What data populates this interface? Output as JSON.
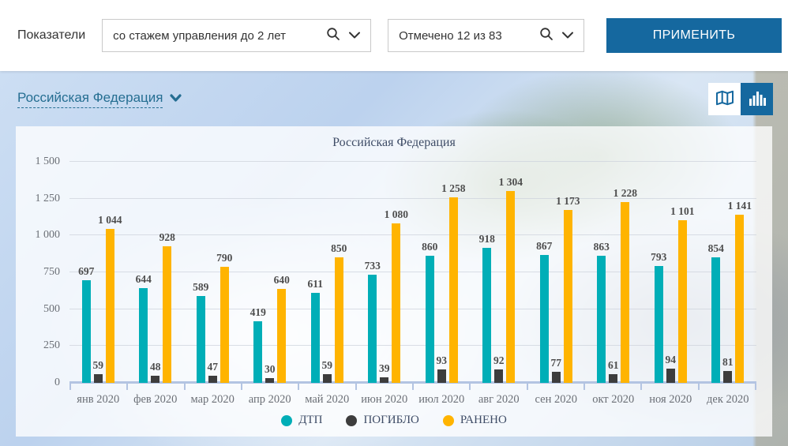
{
  "header": {
    "indicators_label": "Показатели",
    "indicator_select": {
      "value": "со стажем управления до 2 лет"
    },
    "regions_select": {
      "value": "Отмечено 12 из 83"
    },
    "apply_button": "ПРИМЕНИТЬ"
  },
  "breadcrumb": {
    "region": "Российская Федерация"
  },
  "view_toggle": {
    "map_icon": "map-icon",
    "chart_icon": "bar-chart-icon",
    "active": "chart"
  },
  "colors": {
    "accent_blue": "#15689f",
    "link_teal": "#256e92",
    "dtp_teal": "#00aeb7",
    "pogiblo_gray": "#3d3d3d",
    "raneno_orange": "#ffb400"
  },
  "chart_data": {
    "type": "bar",
    "title": "Российская Федерация",
    "categories": [
      "янв 2020",
      "фев 2020",
      "мар 2020",
      "апр 2020",
      "май 2020",
      "июн 2020",
      "июл 2020",
      "авг 2020",
      "сен 2020",
      "окт 2020",
      "ноя 2020",
      "дек 2020"
    ],
    "series": [
      {
        "name": "ДТП",
        "color": "#00aeb7",
        "values": [
          697,
          644,
          589,
          419,
          611,
          733,
          860,
          918,
          867,
          863,
          793,
          854
        ]
      },
      {
        "name": "ПОГИБЛО",
        "color": "#3d3d3d",
        "values": [
          59,
          48,
          47,
          30,
          59,
          39,
          93,
          92,
          77,
          61,
          94,
          81
        ]
      },
      {
        "name": "РАНЕНО",
        "color": "#ffb400",
        "values": [
          1044,
          928,
          790,
          640,
          850,
          1080,
          1258,
          1304,
          1173,
          1228,
          1101,
          1141
        ]
      }
    ],
    "ylim": [
      0,
      1500
    ],
    "yticks": [
      0,
      250,
      500,
      750,
      1000,
      1250,
      1500
    ],
    "grid": true,
    "legend_position": "bottom"
  }
}
